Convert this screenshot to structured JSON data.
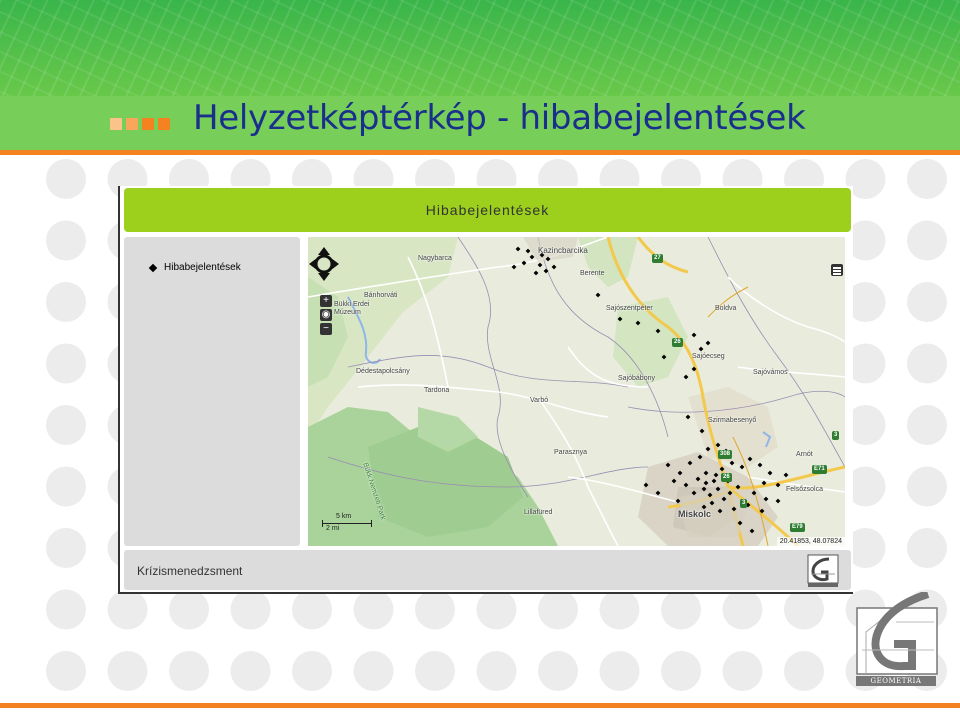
{
  "slide": {
    "title": "Helyzetképtérkép - hibabejelentések",
    "accent_colors": {
      "title": "#1a2f8c",
      "rule": "#f58220",
      "squares": [
        "#f9c38a",
        "#f7a65b",
        "#f58220",
        "#f58220"
      ]
    }
  },
  "app": {
    "header_title": "Hibabejelentések",
    "header_color": "#9dd01c",
    "layers": [
      {
        "label": "Hibabejelentések"
      }
    ],
    "footer_title": "Krízismenedzsment"
  },
  "map": {
    "controls": {
      "zoom_in": "+",
      "zoom_out": "−",
      "globe": "globe-icon",
      "pan": "pan-arrows-icon",
      "layer_switcher": "layers-icon"
    },
    "scale": {
      "top": "5 km",
      "bottom": "2 mi"
    },
    "coordinates": "20.41853, 48.07824",
    "places": [
      "Kazincbarcika",
      "Berente",
      "Nagybarca",
      "Bánhorváti",
      "Bükki Erdei Múzeum",
      "Sajószentpéter",
      "Boldva",
      "Sajóecseg",
      "Sajóvámos",
      "Dédestapolcsány",
      "Tardona",
      "Sajóbábony",
      "Varbó",
      "Szirmabesenyő",
      "Bükk Nemzeti Park",
      "Arnót",
      "Parasznya",
      "Miskolc",
      "Felsőzsolca",
      "Lillafüred"
    ],
    "road_numbers": [
      "27",
      "26",
      "308",
      "3",
      "3",
      "E71",
      "E79",
      "26"
    ],
    "marker_color": "#000000"
  }
}
